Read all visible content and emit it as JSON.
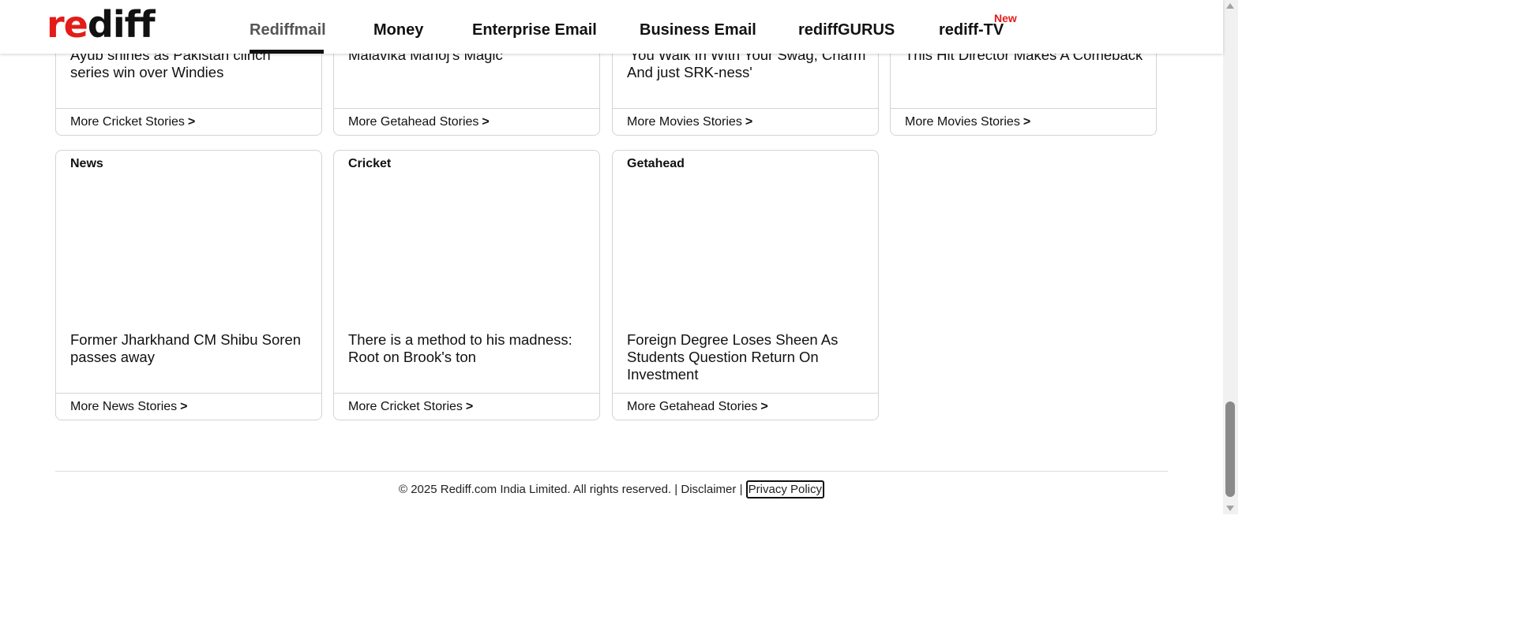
{
  "header": {
    "logo_re": "re",
    "logo_diff": "diff",
    "nav": [
      {
        "label": "Rediffmail"
      },
      {
        "label": "Money"
      },
      {
        "label": "Enterprise Email"
      },
      {
        "label": "Business Email"
      },
      {
        "label": "rediffGURUS"
      },
      {
        "label": "rediff-TV"
      }
    ],
    "new_badge": "New"
  },
  "top_cards": [
    {
      "headline": "Ayub shines as Pakistan clinch series win over Windies",
      "more": "More Cricket Stories",
      "arrow": ">"
    },
    {
      "headline": "Malavika Manoj's Magic",
      "more": "More Getahead Stories",
      "arrow": ">"
    },
    {
      "headline": "'You Walk In With Your Swag, Charm And just SRK-ness'",
      "more": "More Movies Stories",
      "arrow": ">"
    },
    {
      "headline": "This Hit Director Makes A Comeback",
      "more": "More Movies Stories",
      "arrow": ">"
    }
  ],
  "cards": [
    {
      "category": "News",
      "headline": "Former Jharkhand CM Shibu Soren passes away",
      "more": "More News Stories",
      "arrow": ">"
    },
    {
      "category": "Cricket",
      "headline": "There is a method to his madness: Root on Brook's ton",
      "more": "More Cricket Stories",
      "arrow": ">"
    },
    {
      "category": "Getahead",
      "headline": "Foreign Degree Loses Sheen As Students Question Return On Investment",
      "more": "More Getahead Stories",
      "arrow": ">"
    }
  ],
  "footer": {
    "copyright": "© 2025 Rediff.com India Limited. All rights reserved.",
    "sep1": "|",
    "disclaimer": "Disclaimer",
    "sep2": "|",
    "privacy": "Privacy Policy"
  },
  "colors": {
    "brand_red": "#e41b17",
    "text": "#111111",
    "border": "#d4d4d4"
  }
}
